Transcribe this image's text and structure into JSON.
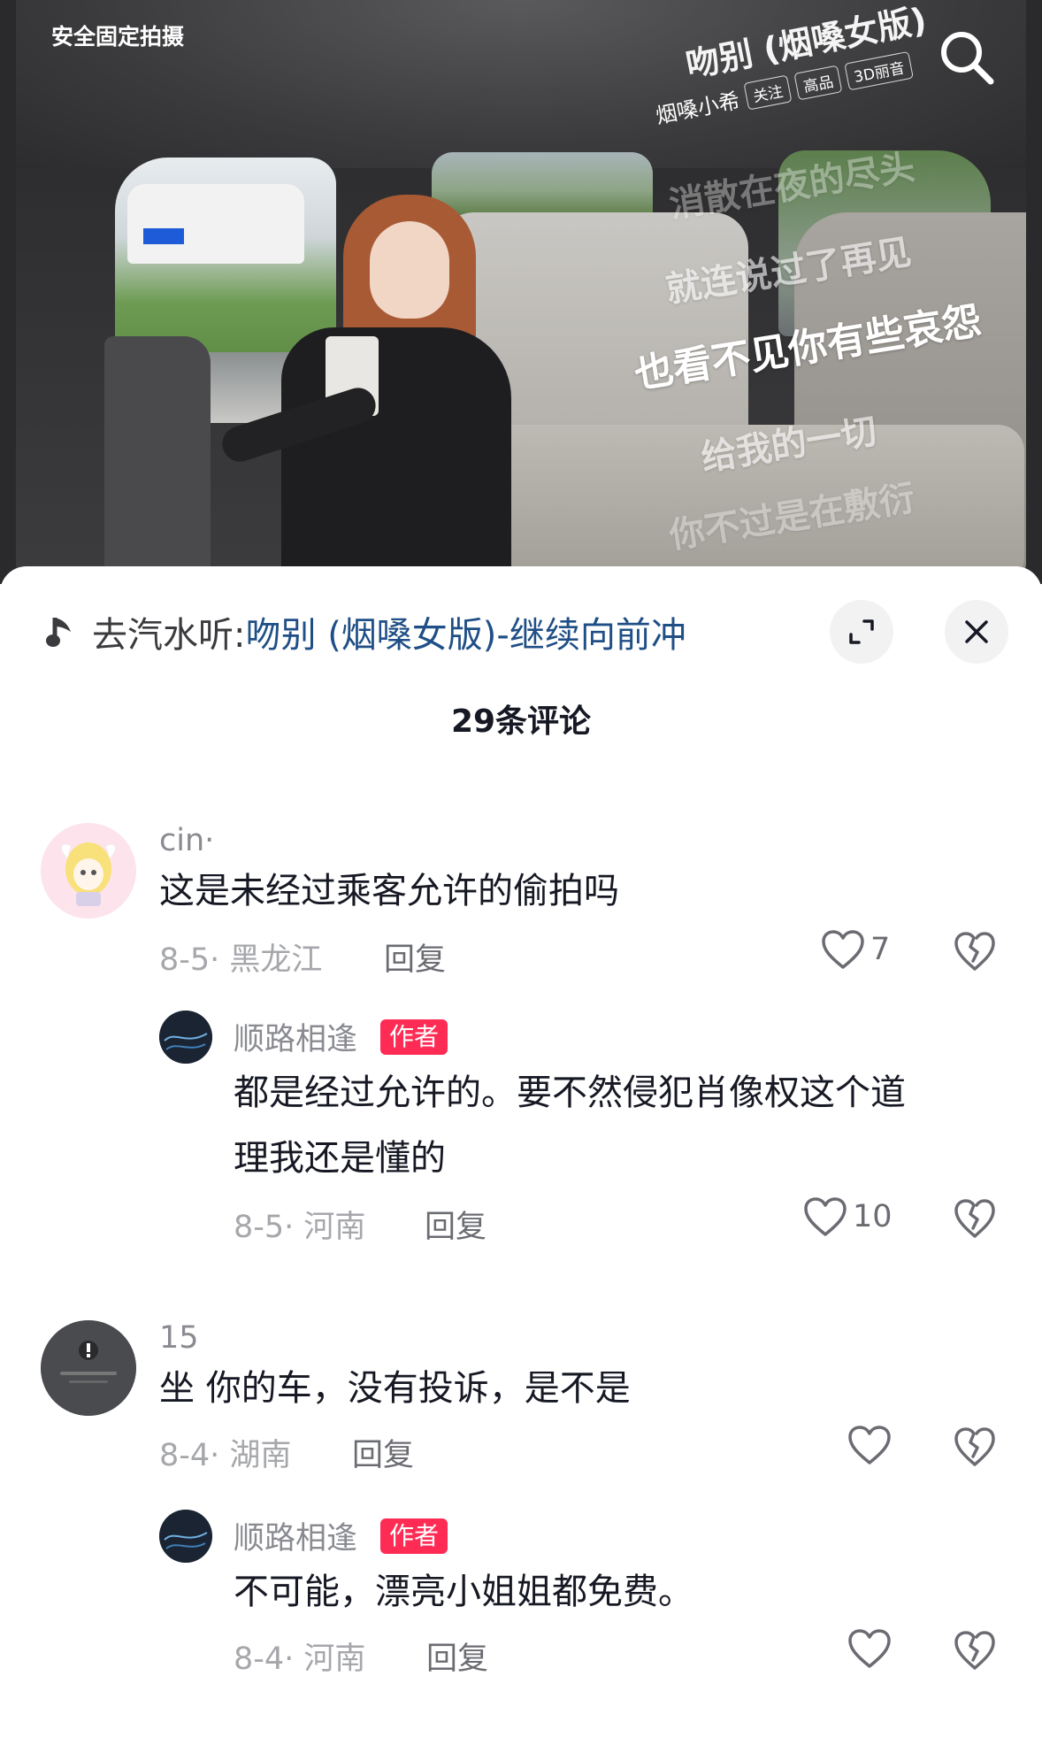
{
  "video": {
    "top_label": "安全固定拍摄",
    "song_title": "吻别 (烟嗓女版)",
    "artist": "烟嗓小希",
    "chips": [
      "关注",
      "高品",
      "3D丽音"
    ],
    "lyrics": [
      "消散在夜的尽头",
      "就连说过了再见",
      "也看不见你有些哀怨",
      "给我的一切",
      "你不过是在敷衍"
    ]
  },
  "sheet": {
    "music_prefix": "去汽水听:",
    "music_link": "吻别 (烟嗓女版)-继续向前冲",
    "comment_count": "29条评论",
    "author_badge": "作者",
    "reply_label": "回复"
  },
  "comments": [
    {
      "user": "cin·",
      "text": "这是未经过乘客允许的偷拍吗",
      "meta": "8-5· 黑龙江",
      "likes": "7",
      "reply": {
        "user": "顺路相逢",
        "text_line1": "都是经过允许的。要不然侵犯肖像权这个道",
        "text_line2": "理我还是懂的",
        "meta": "8-5· 河南",
        "likes": "10"
      }
    },
    {
      "user": "15",
      "text": "坐 你的车，没有投诉，是不是",
      "meta": "8-4· 湖南",
      "likes": "",
      "reply": {
        "user": "顺路相逢",
        "text_line1": "不可能，漂亮小姐姐都免费。",
        "meta": "8-4· 河南",
        "likes": ""
      }
    }
  ],
  "colors": {
    "author_badge": "#fe2c55",
    "link": "#1f4f86",
    "muted": "#a6a7ab"
  },
  "icons": [
    "search-icon",
    "music-note-icon",
    "expand-icon",
    "close-icon",
    "heart-icon",
    "broken-heart-icon"
  ]
}
